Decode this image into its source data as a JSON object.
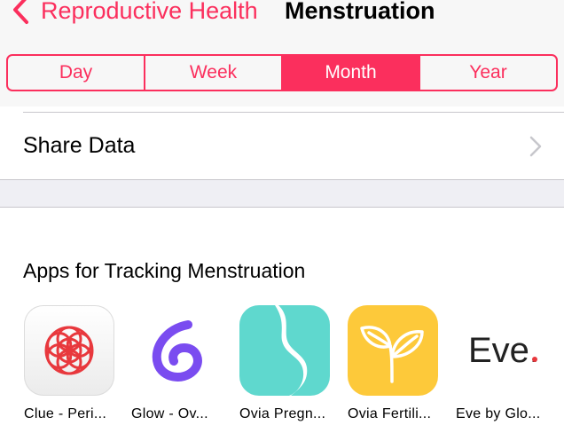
{
  "navbar": {
    "back_label": "Reproductive Health",
    "title": "Menstruation",
    "back_icon": "chevron-left-icon"
  },
  "segments": {
    "items": [
      "Day",
      "Week",
      "Month",
      "Year"
    ],
    "selected": "Month"
  },
  "share": {
    "label": "Share Data",
    "chevron_icon": "chevron-right-icon"
  },
  "apps": {
    "heading": "Apps for Tracking Menstruation",
    "items": [
      {
        "name": "Clue - Peri...",
        "icon": "clue-flower-icon"
      },
      {
        "name": "Glow - Ov...",
        "icon": "glow-g-icon"
      },
      {
        "name": "Ovia Pregn...",
        "icon": "ovia-pregnancy-icon"
      },
      {
        "name": "Ovia Fertili...",
        "icon": "ovia-fertility-leaf-icon"
      },
      {
        "name": "Eve by Glo...",
        "icon": "eve-logo-icon",
        "logo_text": "Eve."
      }
    ]
  },
  "colors": {
    "accent": "#fb2f5d",
    "background": "#efeff4",
    "separator": "#c8c7cc",
    "ovia_pregnancy": "#5fd8ce",
    "ovia_fertility": "#fdc93a",
    "glow_purple": "#7a4cf0"
  }
}
